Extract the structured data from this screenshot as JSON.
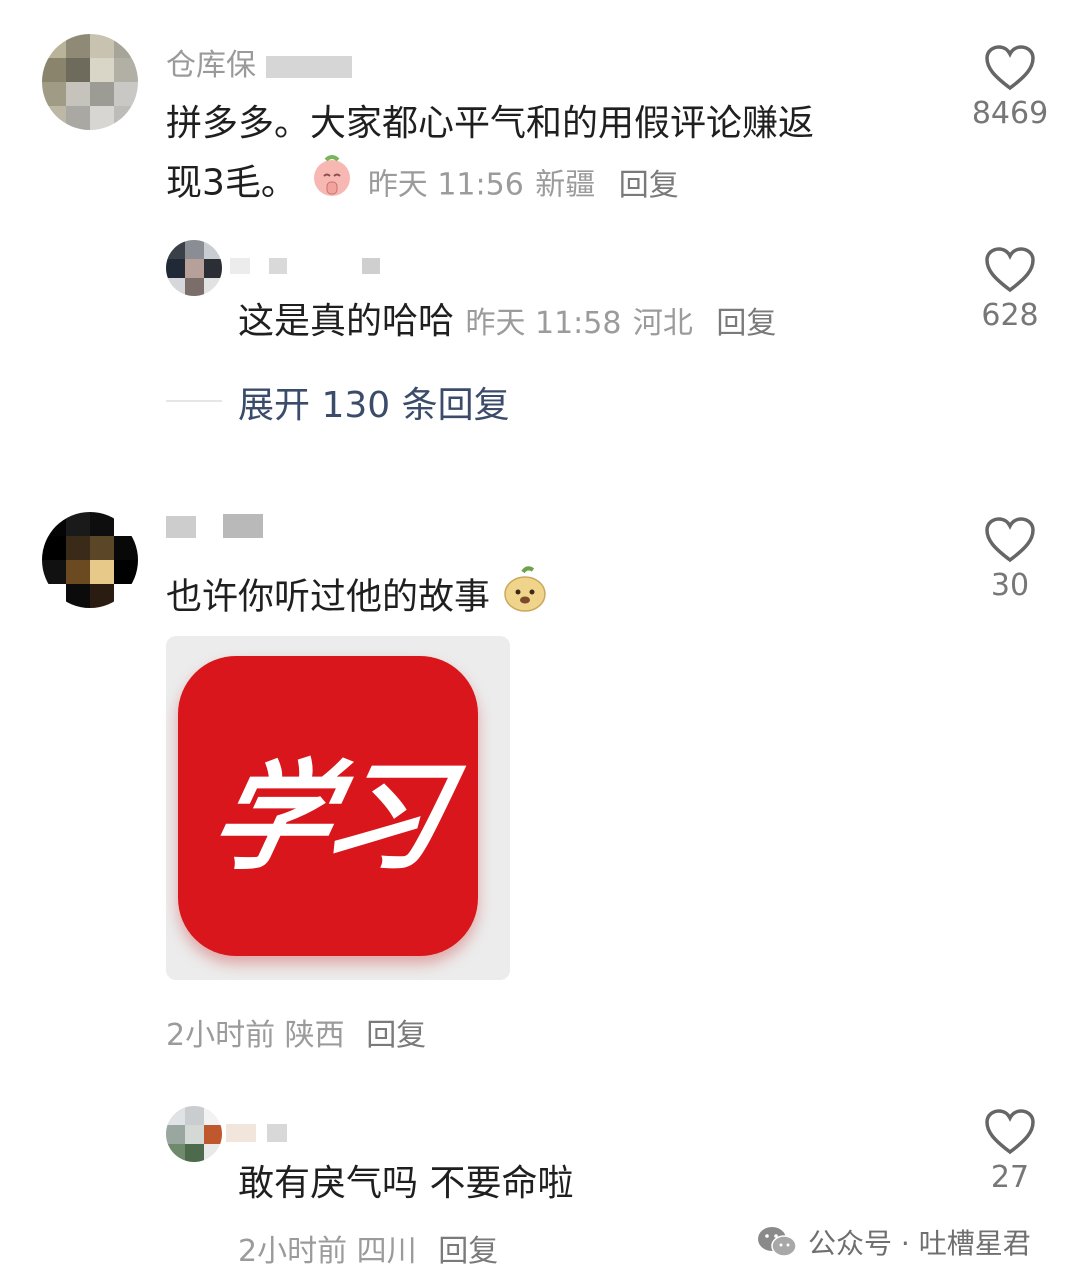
{
  "comments": [
    {
      "username": "仓库保",
      "text_line1": "拼多多。大家都心平气和的用假评论赚返",
      "text_line2": "现3毛。",
      "time": "昨天 11:56",
      "location": "新疆",
      "reply_label": "回复",
      "likes": "8469",
      "emoji": "peach-pray-emoji"
    },
    {
      "text": "这是真的哈哈",
      "time": "昨天 11:58",
      "location": "河北",
      "reply_label": "回复",
      "likes": "628"
    },
    {
      "text": "也许你听过他的故事",
      "emoji": "peach-face-emoji",
      "image_logo_text": "学习",
      "time": "2小时前",
      "location": "陕西",
      "reply_label": "回复",
      "likes": "30"
    },
    {
      "text": "敢有戾气吗 不要命啦",
      "time": "2小时前",
      "location": "四川",
      "reply_label": "回复",
      "likes": "27"
    }
  ],
  "expand_replies": "展开 130 条回复",
  "footer": {
    "account": "公众号 · 吐槽星君"
  },
  "colors": {
    "logo_red": "#d9161c",
    "meta_gray": "#9b9b9b",
    "expand_blue": "#3b4c6b"
  }
}
